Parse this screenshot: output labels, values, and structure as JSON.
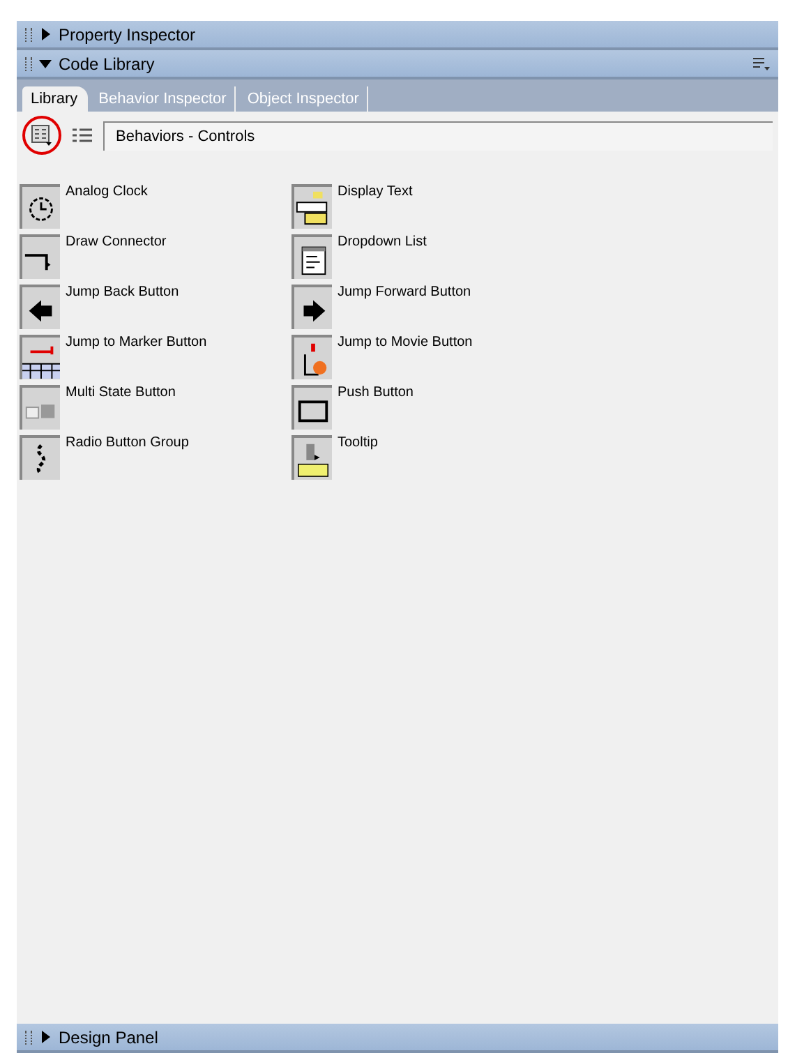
{
  "panels": [
    {
      "title": "Property Inspector",
      "expanded": false
    },
    {
      "title": "Code Library",
      "expanded": true
    }
  ],
  "tabs": [
    {
      "label": "Library",
      "selected": true
    },
    {
      "label": "Behavior Inspector",
      "selected": false
    },
    {
      "label": "Object Inspector",
      "selected": false
    }
  ],
  "category_path": "Behaviors - Controls",
  "items": [
    {
      "label": "Analog Clock"
    },
    {
      "label": "Display Text"
    },
    {
      "label": "Draw Connector"
    },
    {
      "label": "Dropdown List"
    },
    {
      "label": "Jump Back Button"
    },
    {
      "label": "Jump Forward Button"
    },
    {
      "label": "Jump to Marker Button"
    },
    {
      "label": "Jump to Movie Button"
    },
    {
      "label": "Multi State Button"
    },
    {
      "label": "Push Button"
    },
    {
      "label": "Radio Button Group"
    },
    {
      "label": "Tooltip"
    }
  ],
  "bottom_panel": {
    "title": "Design Panel",
    "expanded": false
  }
}
